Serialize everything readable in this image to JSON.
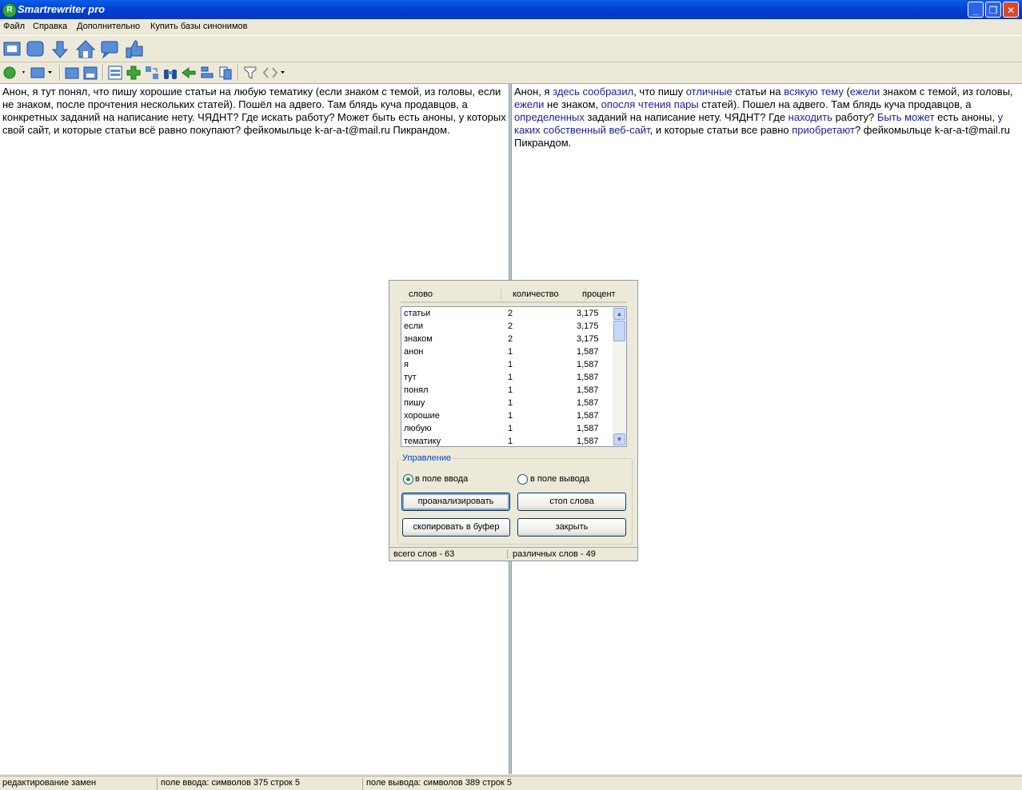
{
  "window": {
    "title": "Smartrewriter pro",
    "app_icon_letter": "R",
    "minimize_glyph": "_",
    "restore_glyph": "❐",
    "close_glyph": "✕"
  },
  "menu": {
    "items": [
      {
        "label": "Файл"
      },
      {
        "label": "Справка"
      },
      {
        "label": "Дополнительно"
      },
      {
        "label": "Купить базы синонимов"
      }
    ]
  },
  "toolbar1": {
    "icons": [
      "window-icon",
      "database-icon",
      "download-icon",
      "home-icon",
      "chat-icon",
      "thumbs-up-icon"
    ]
  },
  "toolbar2": {
    "icons": [
      "refresh-dropdown-icon",
      "folder-dropdown-icon",
      "open-folder-icon",
      "save-icon",
      "split-icon",
      "add-icon",
      "replace-icon",
      "binoculars-icon",
      "back-icon",
      "align-icon",
      "copy-icon",
      "filter-icon",
      "code-dropdown-icon"
    ]
  },
  "input_pane": {
    "text": "Анон, я тут понял, что пишу хорошие статьи на любую тематику (если знаком с темой, из головы, если не знаком, после прочтения нескольких статей). Пошёл на адвего. Там блядь куча продавцов, а конкретных заданий на написание нету. ЧЯДНТ? Где искать работу? Может быть есть аноны, у которых свой сайт, и которые статьи всё равно покупают? фейкомыльце k-ar-a-t@mail.ru Пикрандом."
  },
  "output_pane": {
    "segments": [
      {
        "t": "Анон, я ",
        "syn": false
      },
      {
        "t": "здесь сообразил",
        "syn": true
      },
      {
        "t": ", что пишу ",
        "syn": false
      },
      {
        "t": "отличные",
        "syn": true
      },
      {
        "t": " статьи на ",
        "syn": false
      },
      {
        "t": "всякую тему",
        "syn": true
      },
      {
        "t": " (",
        "syn": false
      },
      {
        "t": "ежели",
        "syn": true
      },
      {
        "t": " знаком с темой, из головы, ",
        "syn": false
      },
      {
        "t": "ежели",
        "syn": true
      },
      {
        "t": " не знаком, ",
        "syn": false
      },
      {
        "t": "опосля чтения пары",
        "syn": true
      },
      {
        "t": " статей). Пошел на адвего. Там блядь куча продавцов, а ",
        "syn": false
      },
      {
        "t": "определенных",
        "syn": true
      },
      {
        "t": " заданий на написание нету. ЧЯДНТ? Где ",
        "syn": false
      },
      {
        "t": "находить",
        "syn": true
      },
      {
        "t": " работу? ",
        "syn": false
      },
      {
        "t": "Быть может",
        "syn": true
      },
      {
        "t": " есть аноны, ",
        "syn": false
      },
      {
        "t": "у каких собственный веб-сайт",
        "syn": true
      },
      {
        "t": ", и которые статьи все равно ",
        "syn": false
      },
      {
        "t": "приобретают",
        "syn": true
      },
      {
        "t": "? фейкомыльце k-ar-a-t@mail.ru Пикрандом.",
        "syn": false
      }
    ],
    "synonym_color": "#1b1ba8"
  },
  "dialog": {
    "columns": {
      "word": "слово",
      "count": "количество",
      "percent": "процент"
    },
    "rows": [
      {
        "word": "статьи",
        "count": "2",
        "percent": "3,175"
      },
      {
        "word": "если",
        "count": "2",
        "percent": "3,175"
      },
      {
        "word": "знаком",
        "count": "2",
        "percent": "3,175"
      },
      {
        "word": "анон",
        "count": "1",
        "percent": "1,587"
      },
      {
        "word": "я",
        "count": "1",
        "percent": "1,587"
      },
      {
        "word": "тут",
        "count": "1",
        "percent": "1,587"
      },
      {
        "word": "понял",
        "count": "1",
        "percent": "1,587"
      },
      {
        "word": "пишу",
        "count": "1",
        "percent": "1,587"
      },
      {
        "word": "хорошие",
        "count": "1",
        "percent": "1,587"
      },
      {
        "word": "любую",
        "count": "1",
        "percent": "1,587"
      },
      {
        "word": "тематику",
        "count": "1",
        "percent": "1,587"
      }
    ],
    "group_label": "Управление",
    "radio_input": {
      "label": "в поле ввода",
      "checked": true
    },
    "radio_output": {
      "label": "в поле вывода",
      "checked": false
    },
    "buttons": {
      "analyze": "проанализировать",
      "stop_words": "стоп слова",
      "copy": "скопировать в буфер",
      "close": "закрыть"
    },
    "status": {
      "total_words": "всего слов - 63",
      "distinct_words": "различных слов - 49"
    },
    "scroll_up_glyph": "▲",
    "scroll_down_glyph": "▼"
  },
  "statusbar": {
    "mode": "редактирование замен",
    "input_info": "поле ввода: символов 375 строк 5",
    "output_info": "поле вывода: символов 389 строк 5"
  }
}
